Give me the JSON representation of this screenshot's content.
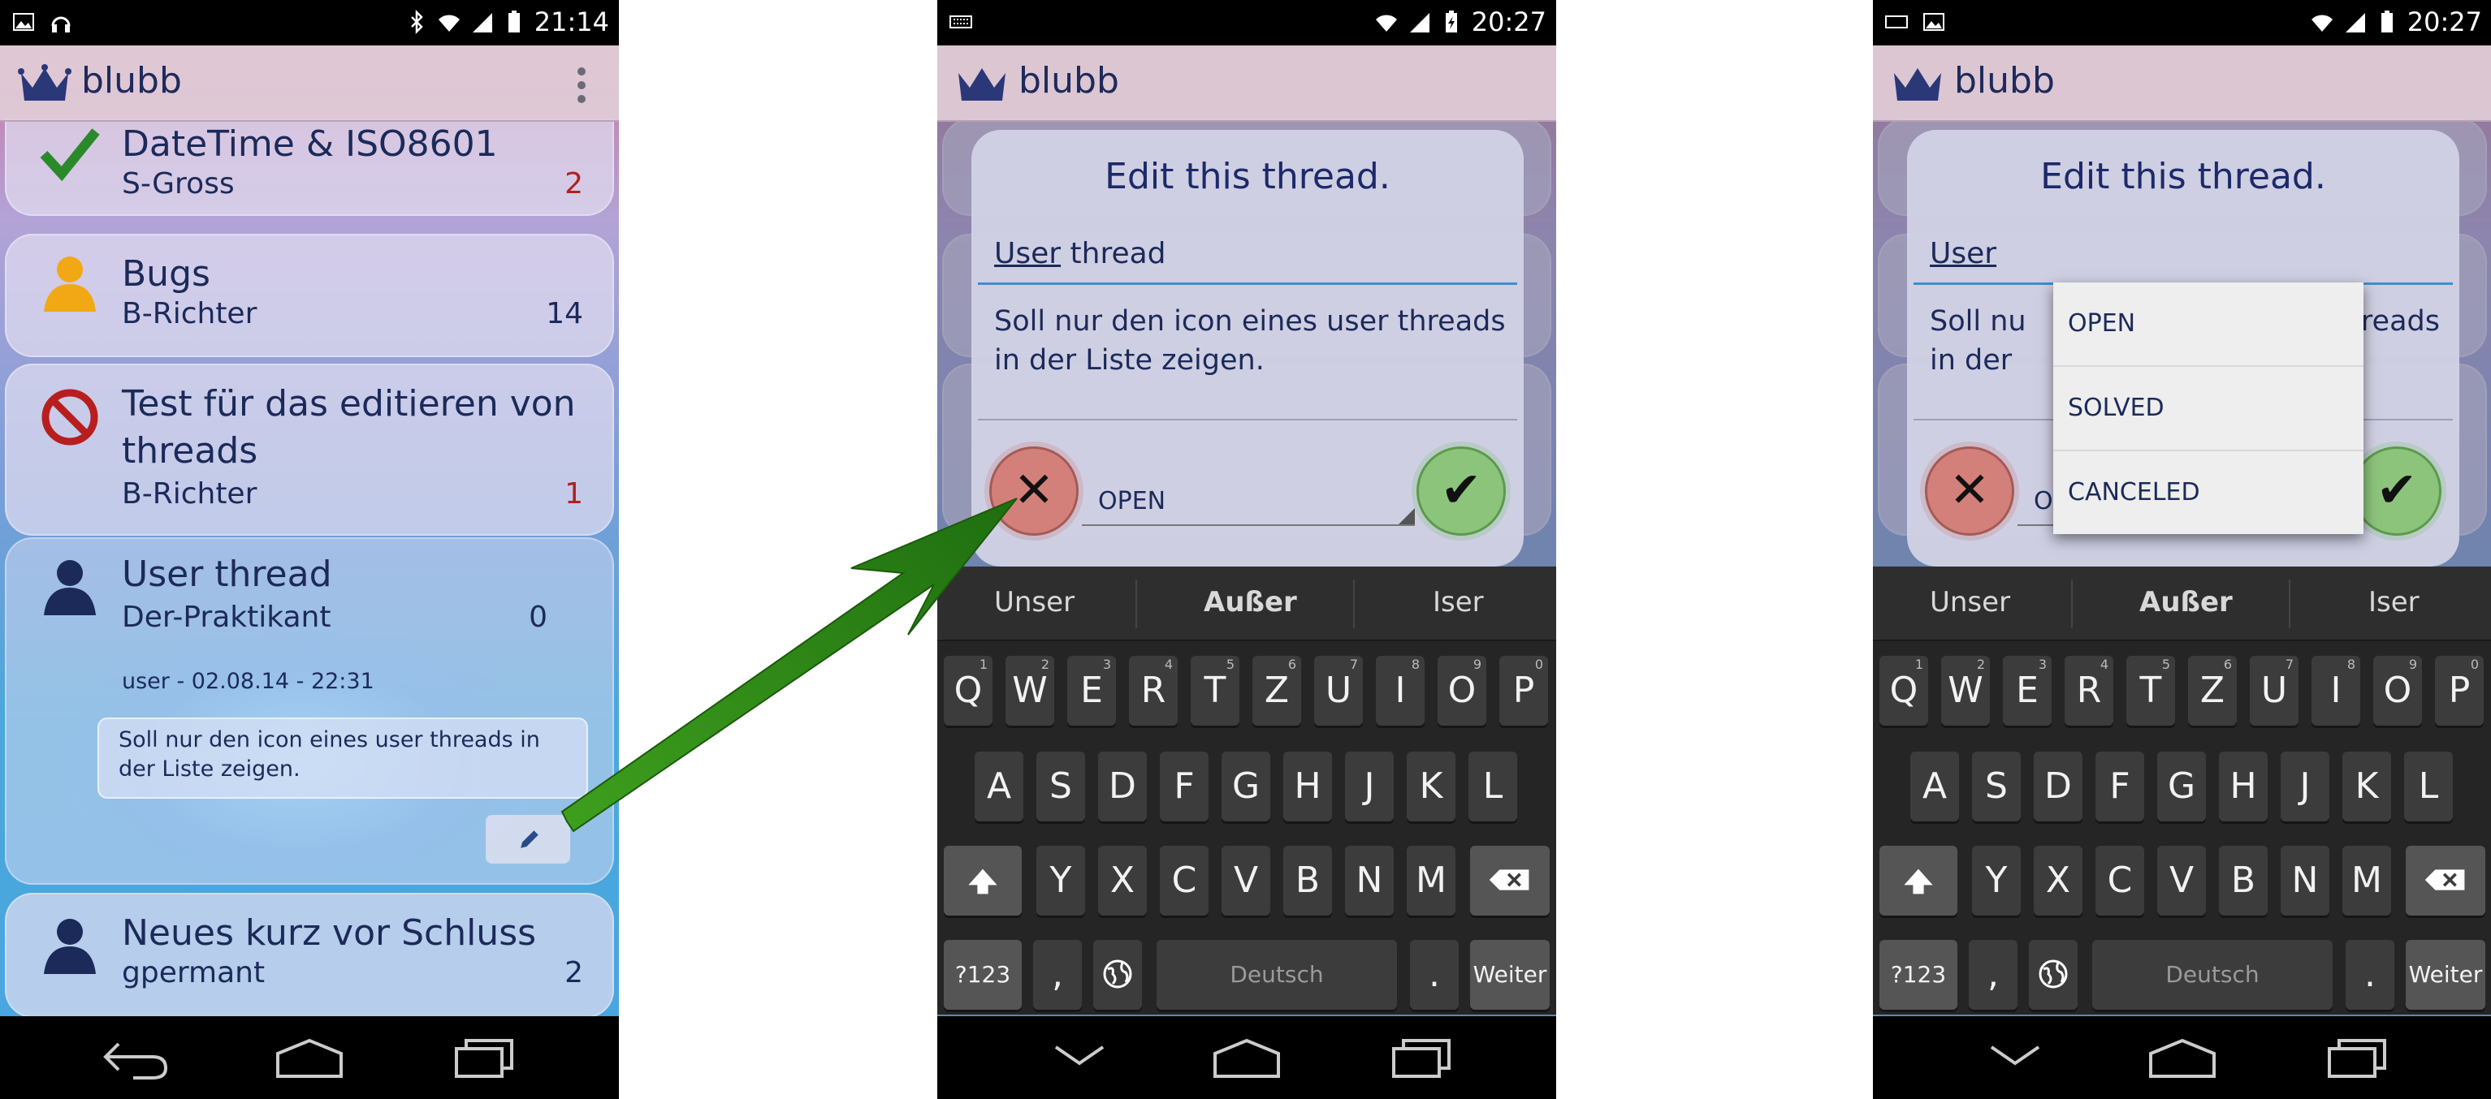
{
  "screen1": {
    "status_time": "21:14",
    "app_title": "blubb",
    "threads": [
      {
        "title": "DateTime & ISO8601",
        "author": "S-Gross",
        "count": "2",
        "icon": "checkmark-icon"
      },
      {
        "title": "Bugs",
        "author": "B-Richter",
        "count": "14",
        "icon": "user-orange-icon"
      },
      {
        "title_line1": "Test für das editieren von",
        "title_line2": "threads",
        "author": "B-Richter",
        "count": "1",
        "icon": "no-entry-icon"
      },
      {
        "title": "User thread",
        "author": "Der-Praktikant",
        "count": "0",
        "meta": "user - 02.08.14 - 22:31",
        "description_line1": "Soll nur den icon eines user threads in",
        "description_line2": "der Liste zeigen.",
        "icon": "user-icon"
      },
      {
        "title": "Neues kurz vor Schluss",
        "author": "gpermant",
        "count": "2",
        "icon": "user-icon"
      }
    ]
  },
  "screen2": {
    "status_time": "20:27",
    "dialog": {
      "title": "Edit this thread.",
      "name_value_underlined": "User",
      "name_value_rest": " thread",
      "description_line1": "Soll nur den icon eines user threads",
      "description_line2": "in der Liste zeigen.",
      "status_value": "OPEN"
    }
  },
  "screen3": {
    "status_time": "20:27",
    "dialog_title": "Edit this thread.",
    "name_value_underlined": "User",
    "desc_left1": "Soll nu",
    "desc_left2": "in der",
    "desc_right1": "hreads",
    "status_value": "OPEN",
    "dropdown_options": [
      "OPEN",
      "SOLVED",
      "CANCELED"
    ]
  },
  "keyboard": {
    "suggestions": [
      "Unser",
      "Außer",
      "Iser"
    ],
    "row1": [
      "Q",
      "W",
      "E",
      "R",
      "T",
      "Z",
      "U",
      "I",
      "O",
      "P"
    ],
    "row1_hints": [
      "1",
      "2",
      "3",
      "4",
      "5",
      "6",
      "7",
      "8",
      "9",
      "0"
    ],
    "row2": [
      "A",
      "S",
      "D",
      "F",
      "G",
      "H",
      "J",
      "K",
      "L"
    ],
    "row3": [
      "Y",
      "X",
      "C",
      "V",
      "B",
      "N",
      "M"
    ],
    "symbols_key": "?123",
    "comma_key": ",",
    "space_label": "Deutsch",
    "period_key": ".",
    "enter_key": "Weiter"
  },
  "colors": {
    "accent": "#3b8fd0",
    "title_text": "#1c2a5a",
    "count_red": "#b02020",
    "arrow_green": "#2f8a1a",
    "cancel_red": "#d4807a",
    "confirm_green": "#8cc47c"
  }
}
